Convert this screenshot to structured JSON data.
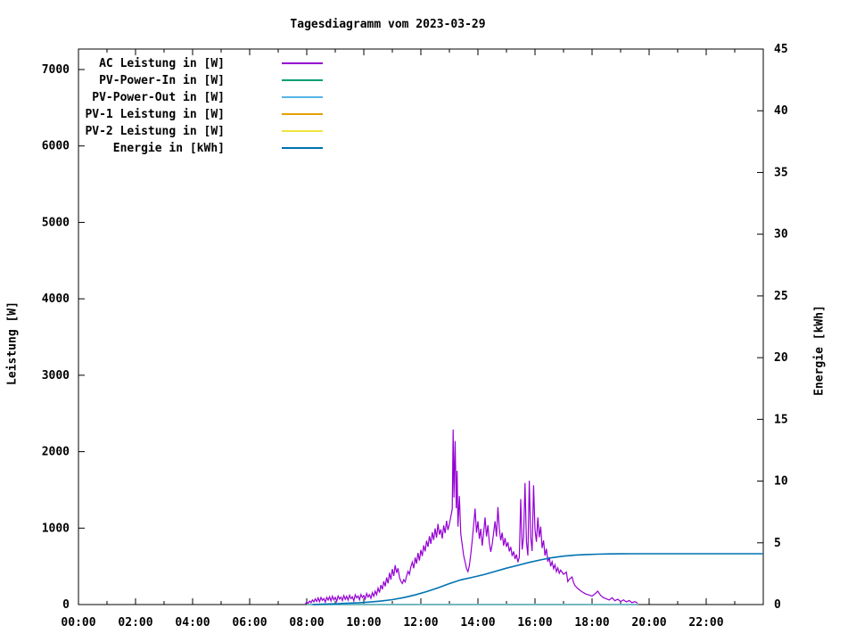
{
  "chart_data": {
    "type": "line",
    "title": "Tagesdiagramm vom 2023-03-29",
    "ylabel_left": "Leistung [W]",
    "ylabel_right": "Energie [kWh]",
    "background": "#ffffff",
    "axis_color": "#000000",
    "grid": false,
    "legend": {
      "position": "top-left",
      "entries": [
        {
          "label": "AC Leistung in [W]",
          "color": "#9400d3"
        },
        {
          "label": "PV-Power-In in [W]",
          "color": "#009e73"
        },
        {
          "label": "PV-Power-Out in [W]",
          "color": "#56b4e9"
        },
        {
          "label": "PV-1 Leistung in [W]",
          "color": "#e69f00"
        },
        {
          "label": "PV-2 Leistung in [W]",
          "color": "#f0e442"
        },
        {
          "label": "Energie in [kWh]",
          "color": "#0072b2"
        }
      ]
    },
    "x_axis": {
      "min": 0,
      "max": 24,
      "major_step": 2,
      "minor_step": 1,
      "tick_labels": [
        "00:00",
        "02:00",
        "04:00",
        "06:00",
        "08:00",
        "10:00",
        "12:00",
        "14:00",
        "16:00",
        "18:00",
        "20:00",
        "22:00"
      ]
    },
    "y_left": {
      "min": 0,
      "max": 7268,
      "major_step": 1000,
      "tick_labels": [
        "0",
        "1000",
        "2000",
        "3000",
        "4000",
        "5000",
        "6000",
        "7000"
      ]
    },
    "y_right": {
      "min": 0,
      "max": 45,
      "major_step": 5,
      "tick_labels": [
        "0",
        "5",
        "10",
        "15",
        "20",
        "25",
        "30",
        "35",
        "40",
        "45"
      ]
    },
    "series": [
      {
        "name": "AC Leistung in [W]",
        "color": "#9400d3",
        "axis": "left",
        "z": 5,
        "width": 1.2,
        "points": [
          [
            7.95,
            12
          ],
          [
            8.0,
            30
          ],
          [
            8.05,
            18
          ],
          [
            8.1,
            45
          ],
          [
            8.15,
            25
          ],
          [
            8.2,
            60
          ],
          [
            8.25,
            35
          ],
          [
            8.3,
            75
          ],
          [
            8.35,
            40
          ],
          [
            8.4,
            88
          ],
          [
            8.45,
            38
          ],
          [
            8.5,
            92
          ],
          [
            8.55,
            55
          ],
          [
            8.6,
            78
          ],
          [
            8.65,
            32
          ],
          [
            8.7,
            95
          ],
          [
            8.75,
            58
          ],
          [
            8.8,
            102
          ],
          [
            8.85,
            48
          ],
          [
            8.9,
            110
          ],
          [
            8.95,
            62
          ],
          [
            9.0,
            95
          ],
          [
            9.05,
            42
          ],
          [
            9.1,
            112
          ],
          [
            9.15,
            72
          ],
          [
            9.2,
            98
          ],
          [
            9.25,
            52
          ],
          [
            9.3,
            118
          ],
          [
            9.35,
            68
          ],
          [
            9.4,
            108
          ],
          [
            9.45,
            58
          ],
          [
            9.5,
            122
          ],
          [
            9.55,
            78
          ],
          [
            9.6,
            102
          ],
          [
            9.65,
            48
          ],
          [
            9.7,
            128
          ],
          [
            9.75,
            88
          ],
          [
            9.8,
            112
          ],
          [
            9.85,
            62
          ],
          [
            9.9,
            132
          ],
          [
            9.95,
            92
          ],
          [
            10.0,
            118
          ],
          [
            10.05,
            72
          ],
          [
            10.1,
            145
          ],
          [
            10.15,
            98
          ],
          [
            10.2,
            128
          ],
          [
            10.25,
            82
          ],
          [
            10.3,
            155
          ],
          [
            10.35,
            108
          ],
          [
            10.4,
            175
          ],
          [
            10.45,
            128
          ],
          [
            10.5,
            215
          ],
          [
            10.55,
            158
          ],
          [
            10.6,
            255
          ],
          [
            10.65,
            198
          ],
          [
            10.7,
            305
          ],
          [
            10.75,
            238
          ],
          [
            10.8,
            355
          ],
          [
            10.85,
            278
          ],
          [
            10.9,
            415
          ],
          [
            10.95,
            325
          ],
          [
            11.0,
            465
          ],
          [
            11.05,
            375
          ],
          [
            11.1,
            515
          ],
          [
            11.15,
            415
          ],
          [
            11.2,
            475
          ],
          [
            11.25,
            355
          ],
          [
            11.3,
            305
          ],
          [
            11.35,
            275
          ],
          [
            11.4,
            325
          ],
          [
            11.45,
            295
          ],
          [
            11.5,
            375
          ],
          [
            11.55,
            435
          ],
          [
            11.6,
            395
          ],
          [
            11.65,
            495
          ],
          [
            11.7,
            555
          ],
          [
            11.75,
            475
          ],
          [
            11.8,
            615
          ],
          [
            11.85,
            535
          ],
          [
            11.9,
            675
          ],
          [
            11.95,
            575
          ],
          [
            12.0,
            715
          ],
          [
            12.05,
            635
          ],
          [
            12.1,
            775
          ],
          [
            12.15,
            695
          ],
          [
            12.2,
            835
          ],
          [
            12.25,
            755
          ],
          [
            12.3,
            895
          ],
          [
            12.35,
            795
          ],
          [
            12.4,
            945
          ],
          [
            12.45,
            845
          ],
          [
            12.5,
            995
          ],
          [
            12.55,
            875
          ],
          [
            12.6,
            1055
          ],
          [
            12.65,
            915
          ],
          [
            12.7,
            985
          ],
          [
            12.75,
            865
          ],
          [
            12.8,
            1035
          ],
          [
            12.85,
            935
          ],
          [
            12.9,
            1095
          ],
          [
            12.95,
            975
          ],
          [
            13.0,
            1055
          ],
          [
            13.05,
            1150
          ],
          [
            13.1,
            1250
          ],
          [
            13.13,
            2290
          ],
          [
            13.16,
            1400
          ],
          [
            13.2,
            2140
          ],
          [
            13.24,
            1260
          ],
          [
            13.27,
            1750
          ],
          [
            13.3,
            1020
          ],
          [
            13.35,
            1420
          ],
          [
            13.4,
            920
          ],
          [
            13.45,
            780
          ],
          [
            13.5,
            640
          ],
          [
            13.55,
            560
          ],
          [
            13.6,
            470
          ],
          [
            13.65,
            430
          ],
          [
            13.7,
            510
          ],
          [
            13.75,
            660
          ],
          [
            13.8,
            840
          ],
          [
            13.85,
            1040
          ],
          [
            13.9,
            1255
          ],
          [
            13.95,
            940
          ],
          [
            14.0,
            1090
          ],
          [
            14.05,
            860
          ],
          [
            14.1,
            990
          ],
          [
            14.15,
            770
          ],
          [
            14.2,
            940
          ],
          [
            14.25,
            1140
          ],
          [
            14.3,
            890
          ],
          [
            14.35,
            1040
          ],
          [
            14.4,
            810
          ],
          [
            14.45,
            690
          ],
          [
            14.5,
            790
          ],
          [
            14.55,
            940
          ],
          [
            14.6,
            1090
          ],
          [
            14.65,
            890
          ],
          [
            14.7,
            1275
          ],
          [
            14.75,
            990
          ],
          [
            14.8,
            840
          ],
          [
            14.85,
            940
          ],
          [
            14.9,
            770
          ],
          [
            14.95,
            870
          ],
          [
            15.0,
            755
          ],
          [
            15.05,
            815
          ],
          [
            15.1,
            695
          ],
          [
            15.15,
            755
          ],
          [
            15.2,
            635
          ],
          [
            15.25,
            695
          ],
          [
            15.3,
            595
          ],
          [
            15.35,
            655
          ],
          [
            15.4,
            555
          ],
          [
            15.45,
            620
          ],
          [
            15.5,
            1380
          ],
          [
            15.55,
            720
          ],
          [
            15.6,
            880
          ],
          [
            15.65,
            1590
          ],
          [
            15.7,
            820
          ],
          [
            15.75,
            640
          ],
          [
            15.8,
            1620
          ],
          [
            15.85,
            880
          ],
          [
            15.9,
            700
          ],
          [
            15.95,
            1560
          ],
          [
            16.0,
            980
          ],
          [
            16.05,
            820
          ],
          [
            16.1,
            1140
          ],
          [
            16.15,
            880
          ],
          [
            16.2,
            1020
          ],
          [
            16.25,
            740
          ],
          [
            16.3,
            840
          ],
          [
            16.35,
            640
          ],
          [
            16.4,
            730
          ],
          [
            16.45,
            560
          ],
          [
            16.5,
            620
          ],
          [
            16.55,
            500
          ],
          [
            16.6,
            560
          ],
          [
            16.65,
            470
          ],
          [
            16.7,
            520
          ],
          [
            16.75,
            430
          ],
          [
            16.8,
            480
          ],
          [
            16.85,
            410
          ],
          [
            16.9,
            450
          ],
          [
            17.0,
            395
          ],
          [
            17.1,
            425
          ],
          [
            17.15,
            300
          ],
          [
            17.2,
            330
          ],
          [
            17.3,
            360
          ],
          [
            17.35,
            290
          ],
          [
            17.4,
            250
          ],
          [
            17.5,
            210
          ],
          [
            17.6,
            180
          ],
          [
            17.7,
            155
          ],
          [
            17.8,
            135
          ],
          [
            17.9,
            125
          ],
          [
            18.0,
            110
          ],
          [
            18.1,
            140
          ],
          [
            18.2,
            175
          ],
          [
            18.3,
            120
          ],
          [
            18.4,
            90
          ],
          [
            18.5,
            75
          ],
          [
            18.6,
            60
          ],
          [
            18.7,
            90
          ],
          [
            18.8,
            50
          ],
          [
            18.9,
            70
          ],
          [
            19.0,
            40
          ],
          [
            19.1,
            62
          ],
          [
            19.2,
            35
          ],
          [
            19.3,
            52
          ],
          [
            19.4,
            25
          ],
          [
            19.5,
            38
          ],
          [
            19.6,
            18
          ]
        ]
      },
      {
        "name": "PV-Power-In in [W]",
        "color": "#009e73",
        "axis": "left",
        "z": 1,
        "width": 1.5,
        "points": [
          [
            8.0,
            0
          ],
          [
            19.6,
            0
          ]
        ]
      },
      {
        "name": "PV-Power-Out in [W]",
        "color": "#56b4e9",
        "axis": "left",
        "z": 4,
        "width": 1.5,
        "points": [
          [
            8.0,
            0
          ],
          [
            19.6,
            0
          ]
        ]
      },
      {
        "name": "PV-1 Leistung in [W]",
        "color": "#e69f00",
        "axis": "left",
        "z": 2,
        "width": 1.5,
        "points": [
          [
            8.0,
            0
          ],
          [
            19.6,
            0
          ]
        ]
      },
      {
        "name": "PV-2 Leistung in [W]",
        "color": "#f0e442",
        "axis": "left",
        "z": 3,
        "width": 1.5,
        "points": [
          [
            8.0,
            0
          ],
          [
            19.6,
            0
          ]
        ]
      },
      {
        "name": "Energie in [kWh]",
        "color": "#0072b2",
        "axis": "right",
        "z": 6,
        "width": 1.6,
        "points": [
          [
            8.2,
            0.0
          ],
          [
            8.6,
            0.03
          ],
          [
            9.0,
            0.06
          ],
          [
            9.4,
            0.1
          ],
          [
            9.8,
            0.14
          ],
          [
            10.2,
            0.2
          ],
          [
            10.6,
            0.28
          ],
          [
            11.0,
            0.4
          ],
          [
            11.4,
            0.56
          ],
          [
            11.8,
            0.78
          ],
          [
            12.2,
            1.05
          ],
          [
            12.6,
            1.35
          ],
          [
            13.0,
            1.7
          ],
          [
            13.4,
            2.0
          ],
          [
            13.8,
            2.2
          ],
          [
            14.2,
            2.42
          ],
          [
            14.6,
            2.68
          ],
          [
            15.0,
            2.95
          ],
          [
            15.4,
            3.18
          ],
          [
            15.8,
            3.42
          ],
          [
            16.2,
            3.62
          ],
          [
            16.6,
            3.8
          ],
          [
            17.0,
            3.92
          ],
          [
            17.4,
            4.0
          ],
          [
            17.8,
            4.05
          ],
          [
            18.2,
            4.08
          ],
          [
            18.6,
            4.1
          ],
          [
            19.0,
            4.11
          ],
          [
            19.5,
            4.12
          ],
          [
            20.0,
            4.12
          ],
          [
            22.0,
            4.12
          ],
          [
            24.0,
            4.12
          ]
        ]
      }
    ]
  }
}
